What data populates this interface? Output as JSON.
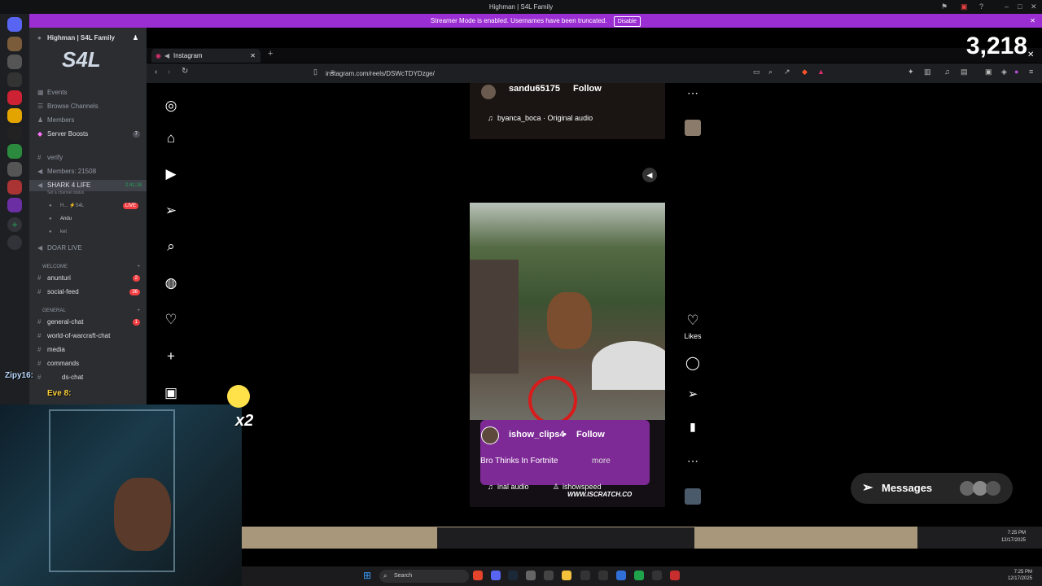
{
  "titlebar": {
    "title": "Highman | S4L Family"
  },
  "streamer_banner": {
    "text": "Streamer Mode is enabled. Usernames have been truncated.",
    "disable_label": "Disable"
  },
  "discord": {
    "server_name": "Highman | S4L Family",
    "server_badges": [
      "130",
      "29",
      "46",
      "29",
      "318"
    ],
    "menu": [
      {
        "label": "Events"
      },
      {
        "label": "Browse Channels"
      },
      {
        "label": "Members"
      },
      {
        "label": "Server Boosts",
        "badge": "7"
      }
    ],
    "channels": [
      {
        "label": "verify"
      },
      {
        "label": "Members: 21508"
      },
      {
        "label": "SHARK 4 LIFE",
        "time": "2:41:18",
        "status": "Set a channel status"
      },
      {
        "label": "H... ⚡S4L",
        "live": "LIVE"
      },
      {
        "label": "Andu"
      },
      {
        "label": "ket"
      },
      {
        "label": "DOAR LIVE"
      },
      {
        "label": "WELCOME",
        "category": true
      },
      {
        "label": "anunturi",
        "badge": "2"
      },
      {
        "label": "social-feed",
        "badge": "36"
      },
      {
        "label": "GENERAL",
        "category": true
      },
      {
        "label": "general-chat",
        "badge": "1"
      },
      {
        "label": "world-of-warcraft-chat"
      },
      {
        "label": "media"
      },
      {
        "label": "commands"
      },
      {
        "label": "ds-chat"
      }
    ]
  },
  "stream_overlay": {
    "viewer_count": "3,218",
    "chat_lines": [
      "Zipy16:",
      "Eve 8:"
    ],
    "combo": "x2"
  },
  "browser": {
    "tab_title": "Instagram",
    "url": "instagram.com/reels/DSWcTDYDzge/"
  },
  "instagram": {
    "prev_reel": {
      "username": "sandu65175",
      "follow": "Follow",
      "audio": "byanca_boca · Original audio"
    },
    "reel": {
      "username": "ishow_clips4",
      "follow": "Follow",
      "caption": "Bro Thinks In Fortnite",
      "caption_more": "more",
      "audio": "inal audio",
      "tagged": "ishowspeed",
      "watermark": "WWW.ISCRATCH.CO"
    },
    "actions": {
      "likes_label": "Likes"
    },
    "messages_label": "Messages"
  },
  "taskbar": {
    "search_label": "Search",
    "time": "7:25 PM",
    "date": "12/17/2025"
  }
}
